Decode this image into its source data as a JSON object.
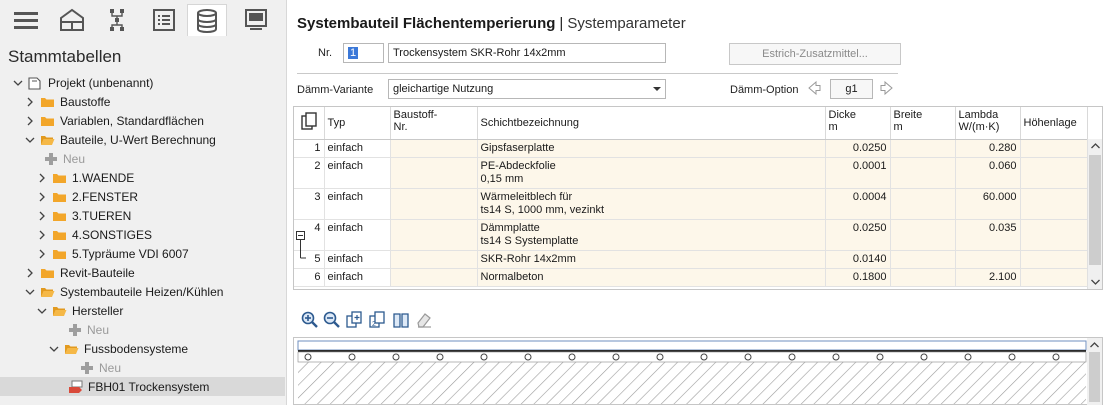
{
  "sidebar": {
    "title": "Stammtabellen",
    "toolbar_icons": [
      "menu-icon",
      "building-icon",
      "network-icon",
      "list-icon",
      "database-icon",
      "monitor-icon"
    ],
    "tree": [
      {
        "label": "Projekt (unbenannt)",
        "expanded": true,
        "icon": "project-icon"
      },
      {
        "label": "Baustoffe",
        "expanded": false,
        "icon": "folder-icon"
      },
      {
        "label": "Variablen, Standardflächen",
        "expanded": false,
        "icon": "folder-icon"
      },
      {
        "label": "Bauteile, U-Wert Berechnung",
        "expanded": true,
        "icon": "folder-icon"
      },
      {
        "label": "Neu",
        "icon": "add-icon"
      },
      {
        "label": "1.WAENDE",
        "expanded": false,
        "icon": "folder-icon"
      },
      {
        "label": "2.FENSTER",
        "expanded": false,
        "icon": "folder-icon"
      },
      {
        "label": "3.TUEREN",
        "expanded": false,
        "icon": "folder-icon"
      },
      {
        "label": "4.SONSTIGES",
        "expanded": false,
        "icon": "folder-icon"
      },
      {
        "label": "5.Typräume VDI 6007",
        "expanded": false,
        "icon": "folder-icon"
      },
      {
        "label": "Revit-Bauteile",
        "expanded": false,
        "icon": "folder-icon"
      },
      {
        "label": "Systembauteile Heizen/Kühlen",
        "expanded": true,
        "icon": "folder-icon"
      },
      {
        "label": "Hersteller",
        "expanded": true,
        "icon": "folder-icon"
      },
      {
        "label": "Neu",
        "icon": "add-icon"
      },
      {
        "label": "Fussbodensysteme",
        "expanded": true,
        "icon": "folder-icon"
      },
      {
        "label": "Neu",
        "icon": "add-icon"
      },
      {
        "label": "FBH01 Trockensystem",
        "icon": "component-icon",
        "selected": true
      }
    ]
  },
  "header": {
    "title": "Systembauteil Flächentemperierung",
    "separator": "|",
    "subtitle": "Systemparameter"
  },
  "form": {
    "nr_label": "Nr.",
    "nr_value": "1",
    "name_value": "Trockensystem SKR-Rohr 14x2mm",
    "estrich_button": "Estrich-Zusatzmittel...",
    "daemm_variante_label": "Dämm-Variante",
    "daemm_variante_value": "gleichartige Nutzung",
    "daemm_option_label": "Dämm-Option",
    "daemm_option_value": "g1"
  },
  "table": {
    "headers": [
      {
        "line1": "Typ",
        "line2": ""
      },
      {
        "line1": "Baustoff-",
        "line2": "Nr."
      },
      {
        "line1": "Schichtbezeichnung",
        "line2": ""
      },
      {
        "line1": "Dicke",
        "line2": "m"
      },
      {
        "line1": "Breite",
        "line2": "m"
      },
      {
        "line1": "Lambda",
        "line2": "W/(m·K)"
      },
      {
        "line1": "Höhenlage",
        "line2": ""
      }
    ],
    "rows": [
      {
        "n": "1",
        "typ": "einfach",
        "baustoff": "",
        "bez1": "Gipsfaserplatte",
        "bez2": "",
        "dicke": "0.0250",
        "breite": "",
        "lambda": "0.280",
        "hoehe": ""
      },
      {
        "n": "2",
        "typ": "einfach",
        "baustoff": "",
        "bez1": "PE-Abdeckfolie",
        "bez2": "0,15 mm",
        "dicke": "0.0001",
        "breite": "",
        "lambda": "0.060",
        "hoehe": ""
      },
      {
        "n": "3",
        "typ": "einfach",
        "baustoff": "",
        "bez1": "Wärmeleitblech für",
        "bez2": "ts14 S, 1000 mm, vezinkt",
        "dicke": "0.0004",
        "breite": "",
        "lambda": "60.000",
        "hoehe": ""
      },
      {
        "n": "4",
        "typ": "einfach",
        "baustoff": "",
        "bez1": "Dämmplatte",
        "bez2": "ts14 S Systemplatte",
        "dicke": "0.0250",
        "breite": "",
        "lambda": "0.035",
        "hoehe": ""
      },
      {
        "n": "5",
        "typ": "einfach",
        "baustoff": "",
        "bez1": "SKR-Rohr 14x2mm",
        "bez2": "",
        "dicke": "0.0140",
        "breite": "",
        "lambda": "",
        "hoehe": ""
      },
      {
        "n": "6",
        "typ": "einfach",
        "baustoff": "",
        "bez1": "Normalbeton",
        "bez2": "",
        "dicke": "0.1800",
        "breite": "",
        "lambda": "2.100",
        "hoehe": ""
      }
    ]
  },
  "bottom_toolbar_icons": [
    "zoom-in-icon",
    "zoom-out-icon",
    "copy-layer-icon",
    "paste-layer-icon",
    "book-icon",
    "erase-icon"
  ],
  "colors": {
    "selection": "#3b78d8",
    "row_cream": "#fdf7ea",
    "folder": "#f2a62a",
    "hatch": "#9b9b9b"
  }
}
